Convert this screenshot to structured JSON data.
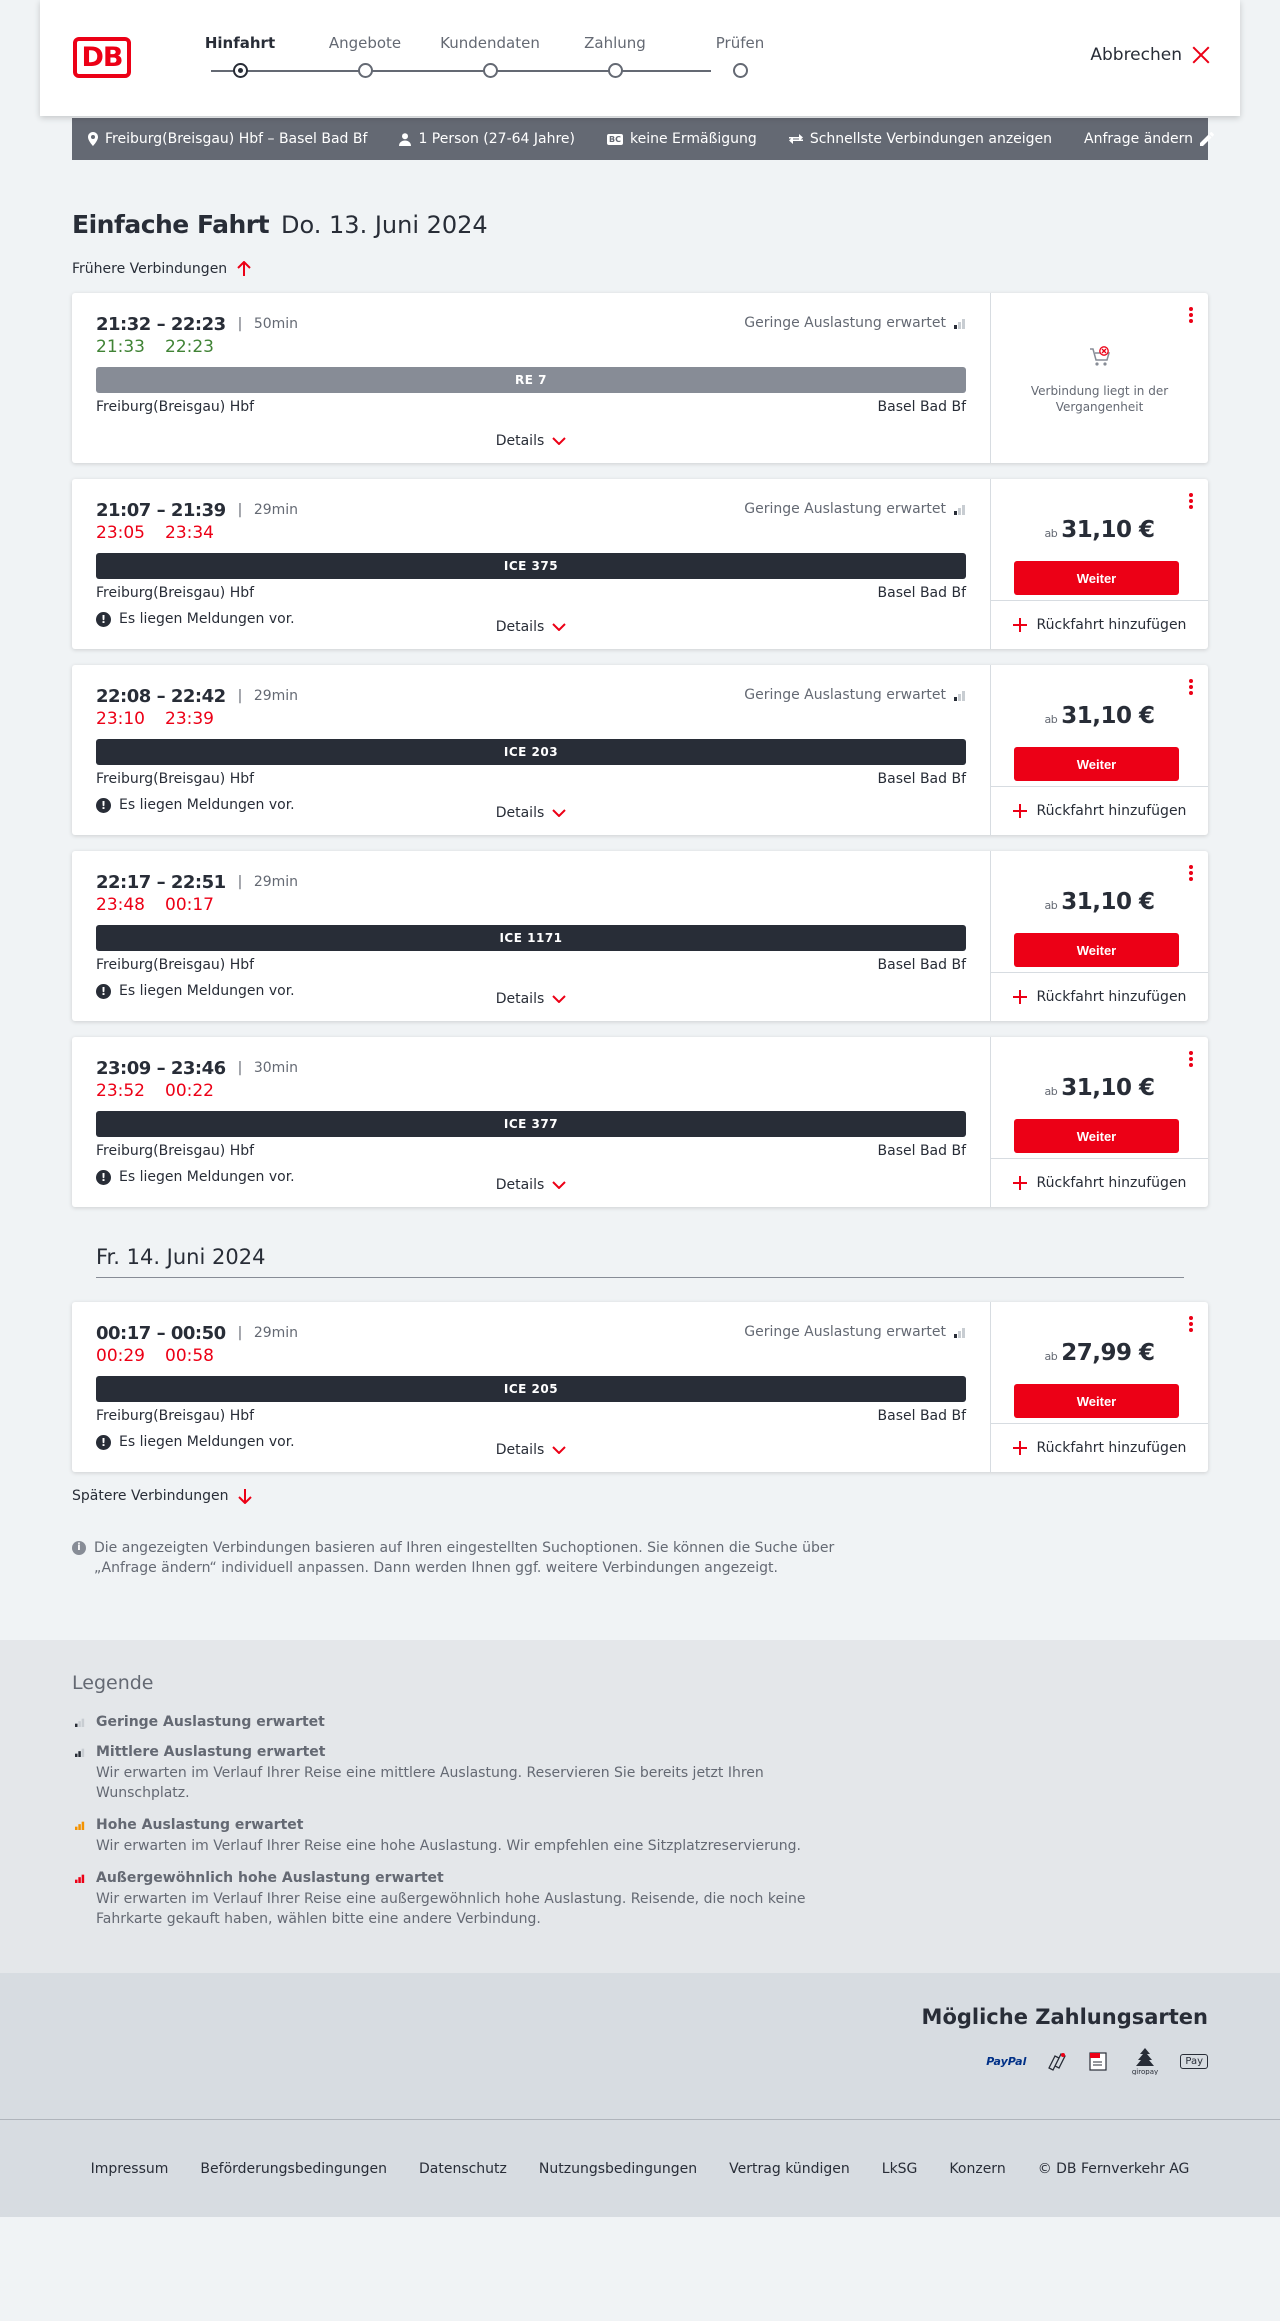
{
  "header": {
    "logo": "DB",
    "steps": [
      "Hinfahrt",
      "Angebote",
      "Kundendaten",
      "Zahlung",
      "Prüfen"
    ],
    "cancel_label": "Abbrechen"
  },
  "query": {
    "route": "Freiburg(Breisgau) Hbf – Basel Bad Bf",
    "passengers": "1 Person (27-64 Jahre)",
    "discount_badge": "BC",
    "discount": "keine Ermäßigung",
    "option": "Schnellste Verbindungen anzeigen",
    "change_label": "Anfrage ändern"
  },
  "page": {
    "title": "Einfache Fahrt",
    "date": "Do. 13. Juni 2024",
    "earlier_label": "Frühere Verbindungen",
    "later_label": "Spätere Verbindungen",
    "day2": "Fr. 14. Juni 2024",
    "info": "Die angezeigten Verbindungen basieren auf Ihren eingestellten Suchoptionen. Sie können die Suche über „Anfrage ändern“ individuell anpassen. Dann werden Ihnen ggf. weitere Verbindungen angezeigt."
  },
  "labels": {
    "occupancy": "Geringe Auslastung erwartet",
    "details": "Details",
    "notice": "Es liegen Meldungen vor.",
    "ab": "ab",
    "weiter": "Weiter",
    "return": "Rückfahrt hinzufügen",
    "past": "Verbindung liegt in der Vergangenheit"
  },
  "connections": [
    {
      "sched": "21:32 – 22:23",
      "duration": "50min",
      "rt_dep": "21:33",
      "rt_arr": "22:23",
      "rt_state": "on-time",
      "train": "RE 7",
      "from": "Freiburg(Breisgau) Hbf",
      "to": "Basel Bad Bf",
      "occupancy": true,
      "notice": false,
      "past": true,
      "price": ""
    },
    {
      "sched": "21:07 – 21:39",
      "duration": "29min",
      "rt_dep": "23:05",
      "rt_arr": "23:34",
      "rt_state": "delayed",
      "train": "ICE 375",
      "from": "Freiburg(Breisgau) Hbf",
      "to": "Basel Bad Bf",
      "occupancy": true,
      "notice": true,
      "past": false,
      "price": "31,10 €"
    },
    {
      "sched": "22:08 – 22:42",
      "duration": "29min",
      "rt_dep": "23:10",
      "rt_arr": "23:39",
      "rt_state": "delayed",
      "train": "ICE 203",
      "from": "Freiburg(Breisgau) Hbf",
      "to": "Basel Bad Bf",
      "occupancy": true,
      "notice": true,
      "past": false,
      "price": "31,10 €"
    },
    {
      "sched": "22:17 – 22:51",
      "duration": "29min",
      "rt_dep": "23:48",
      "rt_arr": "00:17",
      "rt_state": "delayed",
      "train": "ICE 1171",
      "from": "Freiburg(Breisgau) Hbf",
      "to": "Basel Bad Bf",
      "occupancy": false,
      "notice": true,
      "past": false,
      "price": "31,10 €"
    },
    {
      "sched": "23:09 – 23:46",
      "duration": "30min",
      "rt_dep": "23:52",
      "rt_arr": "00:22",
      "rt_state": "delayed",
      "train": "ICE 377",
      "from": "Freiburg(Breisgau) Hbf",
      "to": "Basel Bad Bf",
      "occupancy": false,
      "notice": true,
      "past": false,
      "price": "31,10 €"
    },
    {
      "sched": "00:17 – 00:50",
      "duration": "29min",
      "rt_dep": "00:29",
      "rt_arr": "00:58",
      "rt_state": "delayed",
      "train": "ICE 205",
      "from": "Freiburg(Breisgau) Hbf",
      "to": "Basel Bad Bf",
      "occupancy": true,
      "notice": true,
      "past": false,
      "price": "27,99 €"
    }
  ],
  "legend": {
    "title": "Legende",
    "items": [
      {
        "title": "Geringe Auslastung erwartet",
        "desc": "",
        "color": "#282d37",
        "level": 1
      },
      {
        "title": "Mittlere Auslastung erwartet",
        "desc": "Wir erwarten im Verlauf Ihrer Reise eine mittlere Auslastung. Reservieren Sie bereits jetzt Ihren Wunschplatz.",
        "color": "#282d37",
        "level": 2
      },
      {
        "title": "Hohe Auslastung erwartet",
        "desc": "Wir erwarten im Verlauf Ihrer Reise eine hohe Auslastung. Wir empfehlen eine Sitzplatzreservierung.",
        "color": "#f39200",
        "level": 3
      },
      {
        "title": "Außergewöhnlich hohe Auslastung erwartet",
        "desc": "Wir erwarten im Verlauf Ihrer Reise eine außergewöhnlich hohe Auslastung. Reisende, die noch keine Fahrkarte gekauft haben, wählen bitte eine andere Verbindung.",
        "color": "#ec0016",
        "level": 4
      }
    ]
  },
  "payment": {
    "title": "Mögliche Zahlungsarten",
    "methods": [
      "PayPal",
      "Kreditkarte",
      "SEPA",
      "giropay",
      "Apple Pay"
    ]
  },
  "footer": {
    "links": [
      "Impressum",
      "Beförderungsbedingungen",
      "Datenschutz",
      "Nutzungsbedingungen",
      "Vertrag kündigen",
      "LkSG",
      "Konzern",
      "© DB Fernverkehr AG"
    ]
  },
  "colors": {
    "accent": "#ec0016",
    "on_time": "#408335",
    "delayed": "#ec0016",
    "train_dark": "#282d37",
    "train_past": "#878c96"
  }
}
